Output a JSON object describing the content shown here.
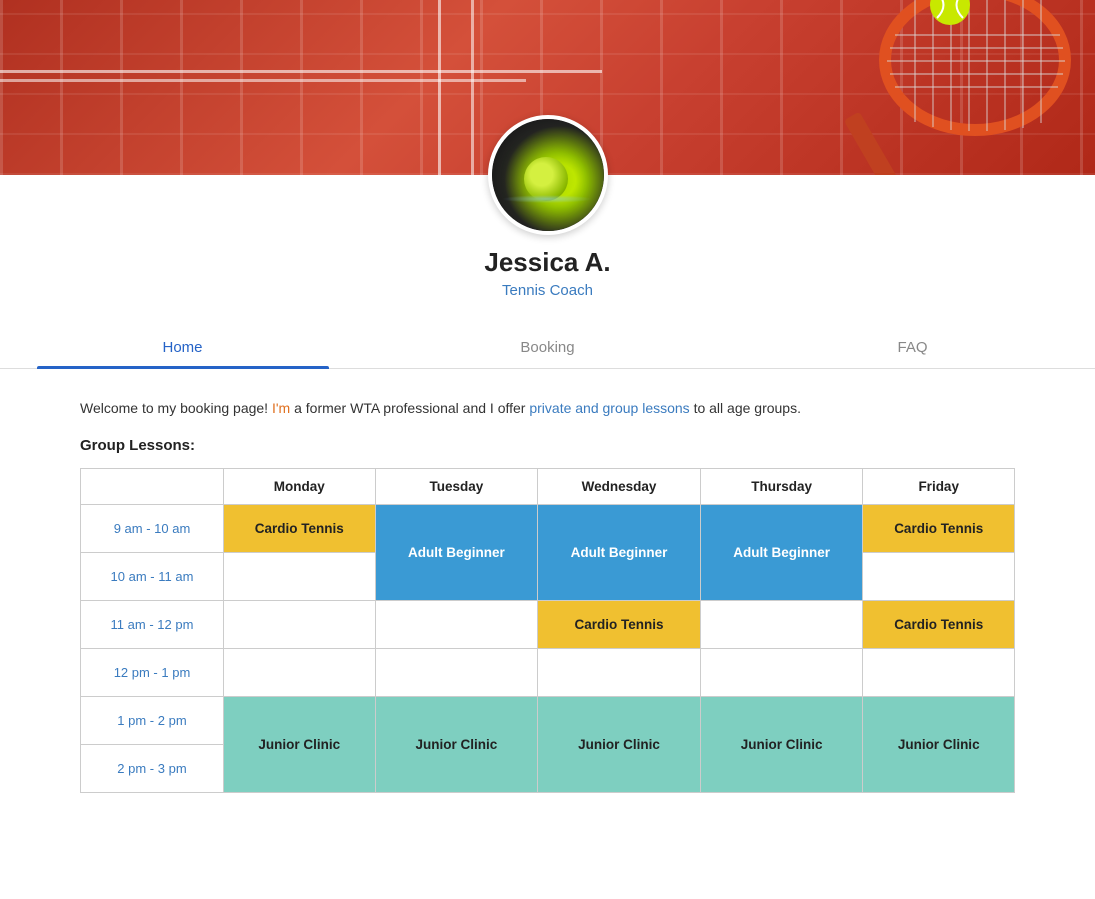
{
  "banner": {
    "alt": "Tennis court banner"
  },
  "profile": {
    "name": "Jessica A.",
    "title": "Tennis Coach",
    "avatar_alt": "Tennis ball avatar"
  },
  "tabs": [
    {
      "id": "home",
      "label": "Home",
      "active": true
    },
    {
      "id": "booking",
      "label": "Booking",
      "active": false
    },
    {
      "id": "faq",
      "label": "FAQ",
      "active": false
    }
  ],
  "welcome": {
    "text_before": "Welcome to my booking page!",
    "text_me": " I'm",
    "text_after": " a former WTA professional and I offer private and group lessons to all age groups."
  },
  "section_title": "Group Lessons:",
  "table": {
    "headers": [
      "",
      "Monday",
      "Tuesday",
      "Wednesday",
      "Thursday",
      "Friday"
    ],
    "rows": [
      {
        "time": "9 am - 10 am",
        "cells": [
          {
            "type": "cardio",
            "label": "Cardio Tennis"
          },
          {
            "type": "adult_start",
            "label": "Adult Beginner",
            "rowspan": 2
          },
          {
            "type": "adult_start",
            "label": "Adult Beginner",
            "rowspan": 2
          },
          {
            "type": "adult_start",
            "label": "Adult Beginner",
            "rowspan": 2
          },
          {
            "type": "cardio",
            "label": "Cardio Tennis"
          }
        ]
      },
      {
        "time": "10 am - 11 am",
        "cells": [
          {
            "type": "empty",
            "label": ""
          },
          {
            "type": "adult_cont",
            "skip": true
          },
          {
            "type": "adult_cont",
            "skip": true
          },
          {
            "type": "adult_cont",
            "skip": true
          },
          {
            "type": "empty",
            "label": ""
          }
        ]
      },
      {
        "time": "11 am - 12 pm",
        "cells": [
          {
            "type": "empty",
            "label": ""
          },
          {
            "type": "empty",
            "label": ""
          },
          {
            "type": "cardio",
            "label": "Cardio Tennis"
          },
          {
            "type": "empty",
            "label": ""
          },
          {
            "type": "cardio",
            "label": "Cardio Tennis"
          }
        ]
      },
      {
        "time": "12 pm - 1 pm",
        "cells": [
          {
            "type": "empty",
            "label": ""
          },
          {
            "type": "empty",
            "label": ""
          },
          {
            "type": "empty",
            "label": ""
          },
          {
            "type": "empty",
            "label": ""
          },
          {
            "type": "empty",
            "label": ""
          }
        ]
      },
      {
        "time": "1 pm - 2 pm",
        "cells": [
          {
            "type": "junior_start",
            "label": "Junior Clinic",
            "rowspan": 2
          },
          {
            "type": "junior_start",
            "label": "Junior Clinic",
            "rowspan": 2
          },
          {
            "type": "junior_start",
            "label": "Junior Clinic",
            "rowspan": 2
          },
          {
            "type": "junior_start",
            "label": "Junior Clinic",
            "rowspan": 2
          },
          {
            "type": "junior_start",
            "label": "Junior Clinic",
            "rowspan": 2
          }
        ]
      },
      {
        "time": "2 pm - 3 pm",
        "cells": [
          {
            "type": "junior_cont",
            "skip": true
          },
          {
            "type": "junior_cont",
            "skip": true
          },
          {
            "type": "junior_cont",
            "skip": true
          },
          {
            "type": "junior_cont",
            "skip": true
          },
          {
            "type": "junior_cont",
            "skip": true
          }
        ]
      }
    ]
  }
}
